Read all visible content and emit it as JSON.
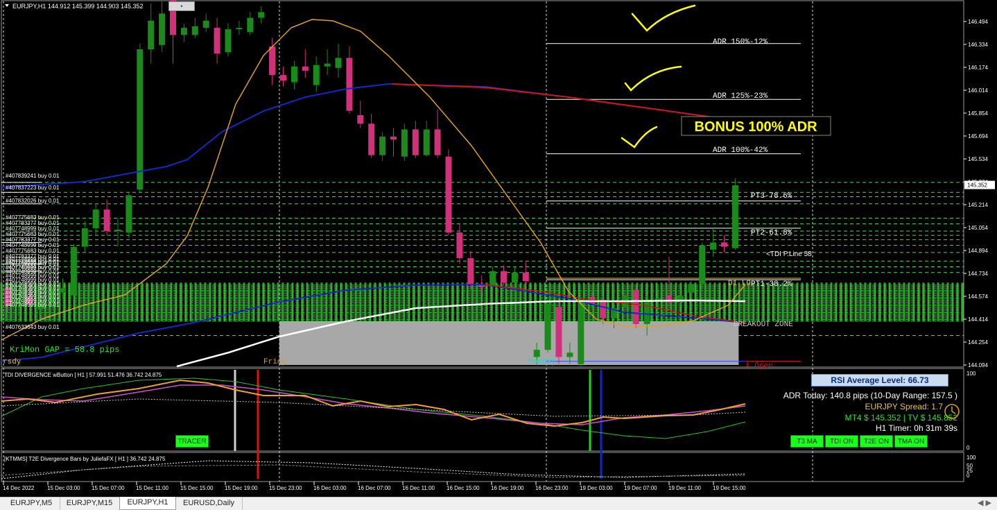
{
  "chart_header": {
    "symbol_tf": "EURJPY,H1",
    "ohlc": "144.912 145.399 144.903 145.352",
    "corner_button": "•"
  },
  "price_axis": [
    "146.494",
    "146.334",
    "146.174",
    "146.014",
    "145.854",
    "145.694",
    "145.534",
    "145.374",
    "145.214",
    "145.054",
    "144.894",
    "144.734",
    "144.574",
    "144.414",
    "144.254",
    "144.094"
  ],
  "current_price": "145.352",
  "time_axis": [
    "14 Dec 2022",
    "15 Dec 03:00",
    "15 Dec 07:00",
    "15 Dec 11:00",
    "15 Dec 15:00",
    "15 Dec 19:00",
    "15 Dec 23:00",
    "16 Dec 03:00",
    "16 Dec 07:00",
    "16 Dec 11:00",
    "16 Dec 15:00",
    "16 Dec 19:00",
    "16 Dec 23:00",
    "19 Dec 03:00",
    "19 Dec 07:00",
    "19 Dec 11:00",
    "19 Dec 15:00"
  ],
  "levels": {
    "adr150": "ADR 150%-12%",
    "adr125": "ADR 125%-23%",
    "adr100": "ADR 100%-42%",
    "pt3": "PT3-78.6%",
    "pt2": "PT2-61.8%",
    "pt1": "PT1-38.2%",
    "tdi_line": "<TDI P.Line 58",
    "d1": "D1 LO",
    "breakout": "BREAKOUT ZONE",
    "d1_open": "1 Open"
  },
  "bonus_label": "BONUS 100% ADR",
  "order_labels": [
    "#407839241 buy 0.01",
    "#407837223 buy 0.01",
    "#407832026 buy 0.01",
    "#407775683 buy 0.01",
    "#407783377 buy 0.01",
    "#407748999 buy 0.01",
    "#407633643 buy 0.01"
  ],
  "gap_label": "KriMon GAP = 58.8 pips",
  "session_labels": {
    "thursday": "rsdy",
    "friday": "Fridy",
    "monday": "Monday"
  },
  "tdi_panel": {
    "title": "TDI DIVERGENCE wButton [ H1 ] 57.991 51.476 36.742 24.875",
    "axis_top": "100",
    "axis_bottom": "0",
    "tracer_button": "TRACER"
  },
  "info_panel": {
    "rsi_avg": "RSI Average Level:  66.73",
    "adr_today": "ADR Today: 140.8 pips (10-Day Range: 157.5 )",
    "spread": "EURJPY Spread: 1.7",
    "prices": "MT4 $ 145.352 | TV $ 145.852",
    "timer": "H1 Timer: 0h 31m 39s",
    "buttons": [
      "T3 MA",
      "TDI ON",
      "T2E ON",
      "TMA ON"
    ]
  },
  "t2e_panel": {
    "title": "[KTMMS] T2E Divergence Bars by JuliefaFX [ H1 ] 36.742 24.875",
    "axis": [
      "100",
      "50",
      "25",
      "0"
    ]
  },
  "tabs": [
    "EURJPY,M5",
    "EURJPY,M15",
    "EURJPY,H1",
    "EURUSD,Daily"
  ],
  "active_tab": "EURJPY,H1",
  "colors": {
    "bull": "#1a8a1a",
    "bear": "#d1307a",
    "ma_orange": "#e0a020",
    "ma_blue": "#1428c8",
    "ma_red": "#d21414",
    "ma_white": "#ffffff",
    "level_green": "#4cd64c",
    "zone_gray": "#a8a8a8"
  },
  "chart_data": {
    "type": "candlestick",
    "symbol": "EURJPY",
    "timeframe": "H1",
    "ylim": [
      144.04,
      146.55
    ],
    "candles": [
      {
        "o": 144.63,
        "h": 144.7,
        "l": 144.46,
        "c": 144.51
      },
      {
        "o": 144.52,
        "h": 144.6,
        "l": 144.44,
        "c": 144.56
      },
      {
        "o": 144.57,
        "h": 144.65,
        "l": 144.49,
        "c": 144.52
      },
      {
        "o": 144.48,
        "h": 144.58,
        "l": 144.44,
        "c": 144.53
      },
      {
        "o": 144.53,
        "h": 144.66,
        "l": 144.5,
        "c": 144.62
      },
      {
        "o": 144.6,
        "h": 144.7,
        "l": 144.56,
        "c": 144.63
      },
      {
        "o": 144.58,
        "h": 144.94,
        "l": 144.55,
        "c": 144.92
      },
      {
        "o": 144.92,
        "h": 145.1,
        "l": 144.88,
        "c": 145.05
      },
      {
        "o": 145.05,
        "h": 145.22,
        "l": 145.0,
        "c": 145.18
      },
      {
        "o": 145.18,
        "h": 145.25,
        "l": 145.0,
        "c": 145.03
      },
      {
        "o": 145.03,
        "h": 145.12,
        "l": 144.92,
        "c": 145.04
      },
      {
        "o": 145.02,
        "h": 145.3,
        "l": 144.98,
        "c": 145.28
      },
      {
        "o": 145.32,
        "h": 146.34,
        "l": 145.3,
        "c": 146.3
      },
      {
        "o": 146.3,
        "h": 146.62,
        "l": 146.2,
        "c": 146.5
      },
      {
        "o": 146.33,
        "h": 146.64,
        "l": 146.28,
        "c": 146.55
      },
      {
        "o": 146.7,
        "h": 146.75,
        "l": 146.2,
        "c": 146.4
      },
      {
        "o": 146.4,
        "h": 146.48,
        "l": 146.35,
        "c": 146.45
      },
      {
        "o": 146.4,
        "h": 146.52,
        "l": 146.38,
        "c": 146.46
      },
      {
        "o": 146.45,
        "h": 146.55,
        "l": 146.42,
        "c": 146.5
      },
      {
        "o": 146.45,
        "h": 146.52,
        "l": 146.2,
        "c": 146.27
      },
      {
        "o": 146.28,
        "h": 146.48,
        "l": 146.25,
        "c": 146.44
      },
      {
        "o": 146.44,
        "h": 146.5,
        "l": 146.4,
        "c": 146.45
      },
      {
        "o": 146.42,
        "h": 146.56,
        "l": 146.4,
        "c": 146.52
      },
      {
        "o": 146.52,
        "h": 146.6,
        "l": 146.48,
        "c": 146.56
      },
      {
        "o": 146.32,
        "h": 146.38,
        "l": 146.05,
        "c": 146.12
      },
      {
        "o": 146.12,
        "h": 146.18,
        "l": 146.04,
        "c": 146.08
      },
      {
        "o": 146.07,
        "h": 146.22,
        "l": 146.02,
        "c": 146.18
      },
      {
        "o": 146.18,
        "h": 146.3,
        "l": 146.1,
        "c": 146.15
      },
      {
        "o": 146.05,
        "h": 146.25,
        "l": 146.0,
        "c": 146.19
      },
      {
        "o": 146.18,
        "h": 146.3,
        "l": 146.12,
        "c": 146.2
      },
      {
        "o": 146.17,
        "h": 146.34,
        "l": 146.1,
        "c": 146.24
      },
      {
        "o": 146.24,
        "h": 146.32,
        "l": 145.85,
        "c": 145.87
      },
      {
        "o": 145.84,
        "h": 145.94,
        "l": 145.75,
        "c": 145.78
      },
      {
        "o": 145.78,
        "h": 145.85,
        "l": 145.54,
        "c": 145.56
      },
      {
        "o": 145.56,
        "h": 145.72,
        "l": 145.52,
        "c": 145.69
      },
      {
        "o": 145.69,
        "h": 145.75,
        "l": 145.55,
        "c": 145.67
      },
      {
        "o": 145.55,
        "h": 145.78,
        "l": 145.52,
        "c": 145.74
      },
      {
        "o": 145.74,
        "h": 145.8,
        "l": 145.54,
        "c": 145.56
      },
      {
        "o": 145.56,
        "h": 145.8,
        "l": 145.55,
        "c": 145.74
      },
      {
        "o": 145.74,
        "h": 145.88,
        "l": 145.54,
        "c": 145.56
      },
      {
        "o": 145.55,
        "h": 145.6,
        "l": 145.0,
        "c": 145.02
      },
      {
        "o": 145.02,
        "h": 145.08,
        "l": 144.8,
        "c": 144.84
      },
      {
        "o": 144.84,
        "h": 144.89,
        "l": 144.62,
        "c": 144.65
      },
      {
        "o": 144.65,
        "h": 144.72,
        "l": 144.6,
        "c": 144.64
      },
      {
        "o": 144.64,
        "h": 144.78,
        "l": 144.62,
        "c": 144.75
      },
      {
        "o": 144.75,
        "h": 144.79,
        "l": 144.65,
        "c": 144.67
      },
      {
        "o": 144.67,
        "h": 144.78,
        "l": 144.62,
        "c": 144.74
      },
      {
        "o": 144.74,
        "h": 144.82,
        "l": 144.65,
        "c": 144.68
      },
      {
        "o": 144.15,
        "h": 144.25,
        "l": 144.1,
        "c": 144.2
      },
      {
        "o": 144.2,
        "h": 144.55,
        "l": 144.18,
        "c": 144.52
      },
      {
        "o": 144.5,
        "h": 144.55,
        "l": 144.1,
        "c": 144.15
      },
      {
        "o": 144.15,
        "h": 144.25,
        "l": 144.1,
        "c": 144.18
      },
      {
        "o": 144.1,
        "h": 144.59,
        "l": 144.08,
        "c": 144.55
      },
      {
        "o": 144.57,
        "h": 144.6,
        "l": 144.5,
        "c": 144.52
      },
      {
        "o": 144.55,
        "h": 144.58,
        "l": 144.38,
        "c": 144.42
      },
      {
        "o": 144.42,
        "h": 144.5,
        "l": 144.35,
        "c": 144.49
      },
      {
        "o": 144.5,
        "h": 144.62,
        "l": 144.46,
        "c": 144.58
      },
      {
        "o": 144.62,
        "h": 144.65,
        "l": 144.35,
        "c": 144.38
      },
      {
        "o": 144.38,
        "h": 144.58,
        "l": 144.3,
        "c": 144.55
      },
      {
        "o": 144.55,
        "h": 144.62,
        "l": 144.5,
        "c": 144.56
      },
      {
        "o": 144.58,
        "h": 144.85,
        "l": 144.5,
        "c": 144.53
      },
      {
        "o": 144.53,
        "h": 144.62,
        "l": 144.5,
        "c": 144.58
      },
      {
        "o": 144.6,
        "h": 144.68,
        "l": 144.55,
        "c": 144.66
      },
      {
        "o": 144.66,
        "h": 144.95,
        "l": 144.62,
        "c": 144.93
      },
      {
        "o": 144.9,
        "h": 145.05,
        "l": 144.85,
        "c": 144.95
      },
      {
        "o": 144.95,
        "h": 145.0,
        "l": 144.88,
        "c": 144.92
      },
      {
        "o": 144.91,
        "h": 145.4,
        "l": 144.9,
        "c": 145.35
      }
    ]
  }
}
